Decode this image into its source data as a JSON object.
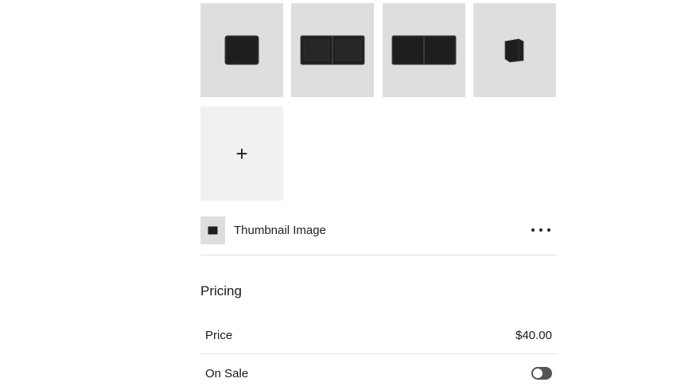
{
  "gallery": {
    "images": [
      {
        "name": "wallet-closed-front",
        "icon": "wallet-closed-icon"
      },
      {
        "name": "wallet-open-inside",
        "icon": "wallet-open-icon"
      },
      {
        "name": "wallet-open-outside",
        "icon": "wallet-open-icon"
      },
      {
        "name": "wallet-standing",
        "icon": "wallet-standing-icon"
      }
    ],
    "add_icon": "+"
  },
  "thumbnail": {
    "label": "Thumbnail Image",
    "menu_icon": "more-horizontal-icon"
  },
  "pricing": {
    "title": "Pricing",
    "price_label": "Price",
    "price_value": "$40.00",
    "on_sale_label": "On Sale",
    "on_sale": false
  },
  "colors": {
    "tile_bg": "#dedede",
    "add_tile_bg": "#f1f1f1",
    "toggle_off": "#555555",
    "wallet": "#1e1e1e"
  }
}
